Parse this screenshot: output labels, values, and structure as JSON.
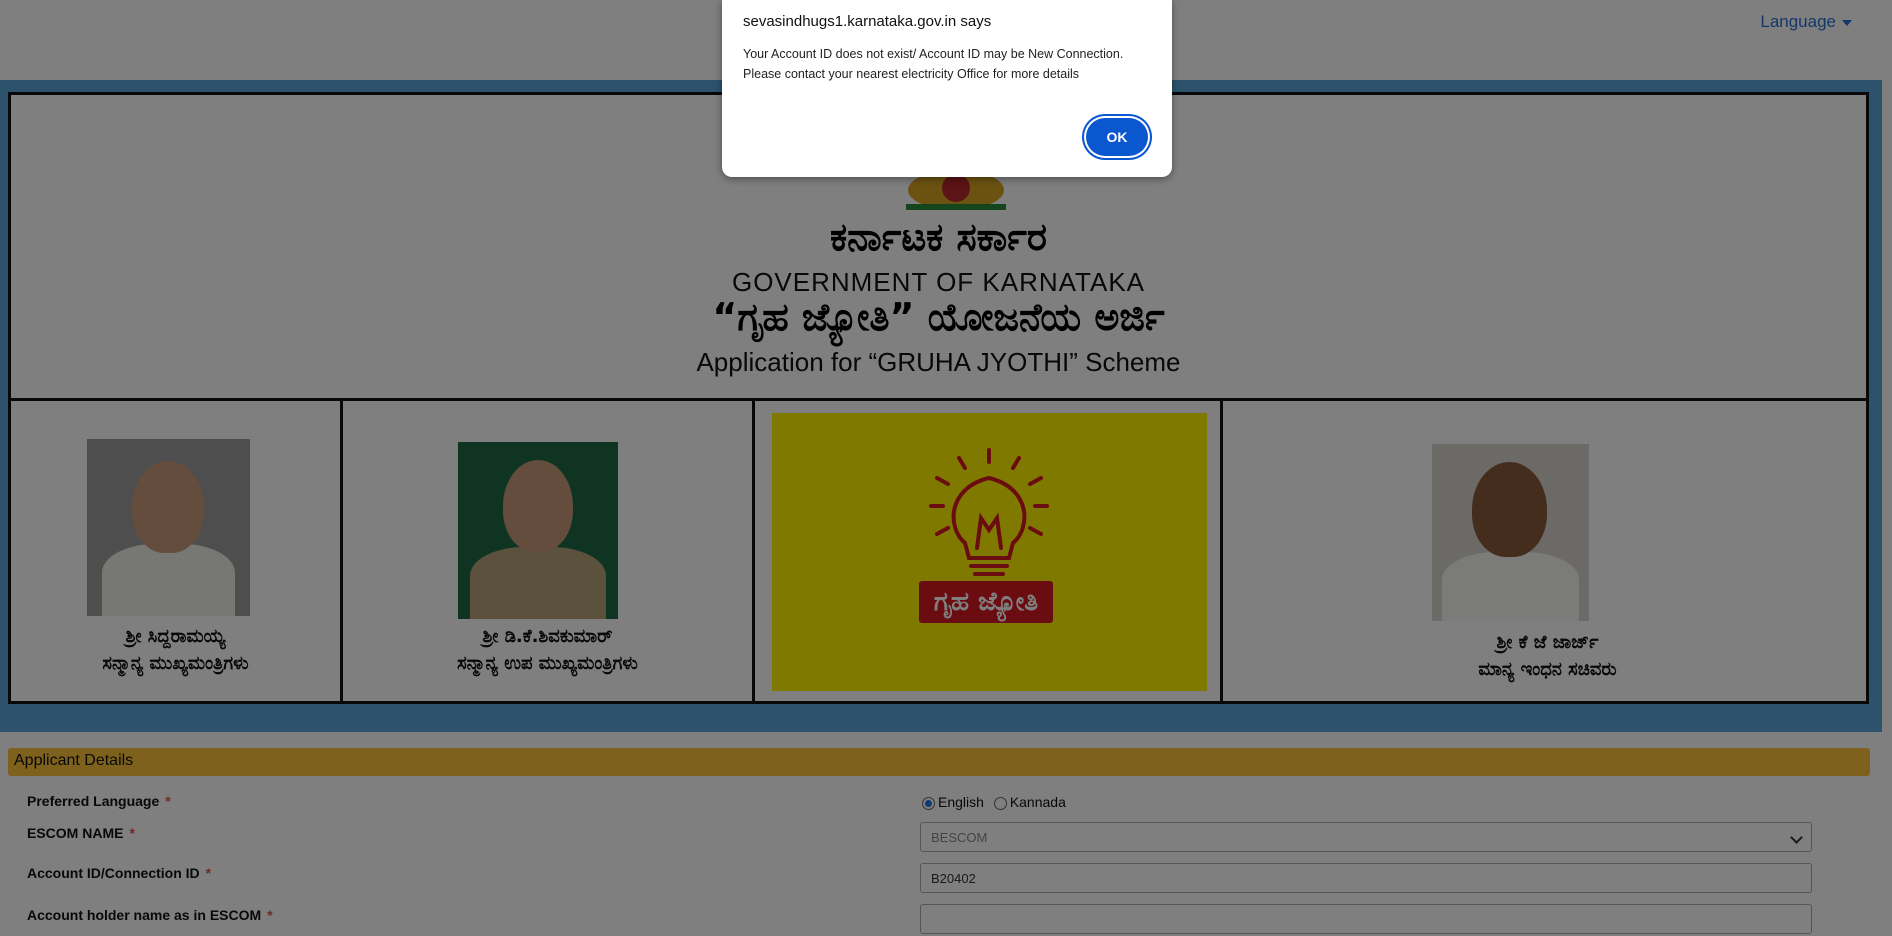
{
  "header": {
    "language_label": "Language"
  },
  "banner": {
    "kannada_govt": "ಕರ್ನಾಟಕ ಸರ್ಕಾರ",
    "govt_title": "GOVERNMENT OF KARNATAKA",
    "kannada_scheme": "“ಗೃಹ ಜ್ಯೋತಿ” ಯೋಜನೆಯ ಅರ್ಜಿ",
    "scheme_title": "Application for “GRUHA JYOTHI” Scheme",
    "people": [
      {
        "name": "ಶ್ರೀ ಸಿದ್ದರಾಮಯ್ಯ",
        "role": "ಸನ್ಮಾನ್ಯ ಮುಖ್ಯಮಂತ್ರಿಗಳು"
      },
      {
        "name": "ಶ್ರೀ ಡಿ.ಕೆ.ಶಿವಕುಮಾರ್",
        "role": "ಸನ್ಮಾನ್ಯ ಉಪ ಮುಖ್ಯಮಂತ್ರಿಗಳು"
      },
      {
        "name": "ಶ್ರೀ ಕೆ ಜೆ ಜಾರ್ಜ್",
        "role": "ಮಾನ್ಯ ಇಂಧನ ಸಚಿವರು"
      }
    ],
    "logo_text": "ಗೃಹ ಜ್ಯೋತಿ",
    "colors": {
      "banner_bg": "#5aa4d6",
      "logo_yellow": "#fff200",
      "logo_red": "#d71920"
    }
  },
  "form": {
    "section_title": "Applicant Details",
    "preferred_language_label": "Preferred Language",
    "language_options": [
      "English",
      "Kannada"
    ],
    "language_selected": "English",
    "escom_label": "ESCOM NAME",
    "escom_value": "BESCOM",
    "account_id_label": "Account ID/Connection ID",
    "account_id_value": "B20402",
    "account_holder_label": "Account holder name as in ESCOM",
    "account_holder_value": "",
    "required_marker": "*"
  },
  "dialog": {
    "title": "sevasindhugs1.karnataka.gov.in says",
    "message_line1": "Your Account ID does not exist/ Account ID may be New Connection.",
    "message_line2": "Please contact your nearest electricity Office for more details",
    "ok_label": "OK"
  }
}
